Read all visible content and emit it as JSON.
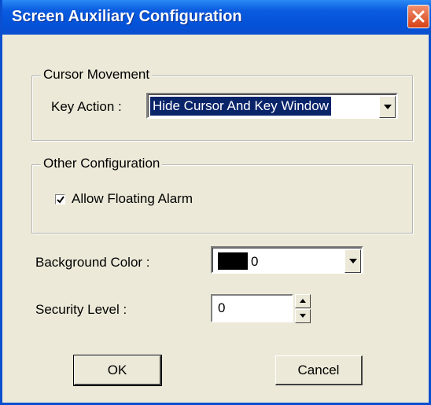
{
  "window": {
    "title": "Screen Auxiliary Configuration",
    "close_icon": "close-x-icon",
    "titlebar_color": "#0a4fcf",
    "close_color": "#d64015"
  },
  "cursor_group": {
    "label": "Cursor Movement",
    "key_action_label": "Key Action :",
    "key_action_value": "Hide Cursor And Key Window"
  },
  "other_group": {
    "label": "Other Configuration",
    "allow_floating_alarm_label": "Allow Floating Alarm",
    "allow_floating_alarm_checked": true
  },
  "background_color": {
    "label": "Background Color :",
    "value": "0",
    "swatch_color": "#000000"
  },
  "security_level": {
    "label": "Security Level :",
    "value": "0"
  },
  "buttons": {
    "ok": "OK",
    "cancel": "Cancel"
  }
}
